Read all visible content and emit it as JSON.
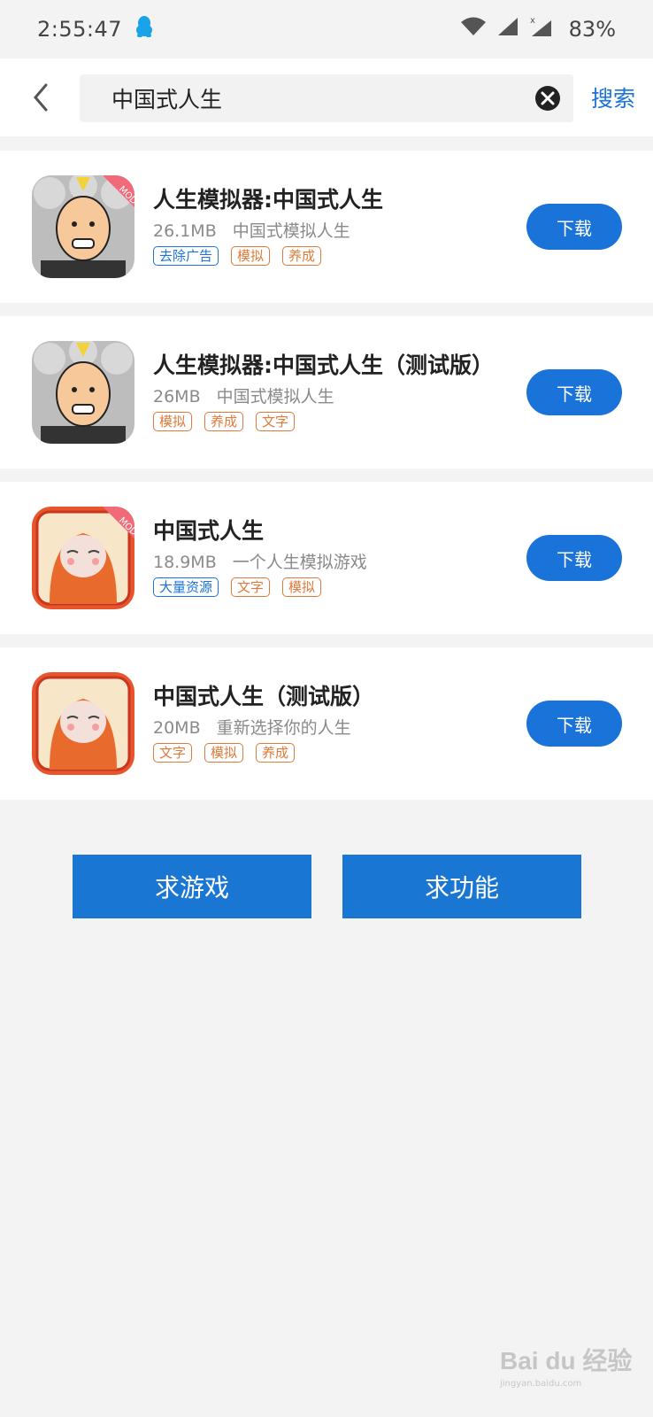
{
  "status_bar": {
    "time": "2:55:47",
    "battery": "83%",
    "icons": [
      "qq-icon",
      "wifi-icon",
      "signal-icon",
      "signal-no-service-icon"
    ]
  },
  "search": {
    "query": "中国式人生",
    "button_label": "搜索"
  },
  "results": [
    {
      "title": "人生模拟器:中国式人生",
      "size": "26.1MB",
      "desc": "中国式模拟人生",
      "tags": [
        {
          "label": "去除广告",
          "color": "#1a73d9"
        },
        {
          "label": "模拟",
          "color": "#e07a3a"
        },
        {
          "label": "养成",
          "color": "#e07a3a"
        }
      ],
      "button": "下载",
      "badge": "MOD"
    },
    {
      "title": "人生模拟器:中国式人生（测试版）",
      "size": "26MB",
      "desc": "中国式模拟人生",
      "tags": [
        {
          "label": "模拟",
          "color": "#e07a3a"
        },
        {
          "label": "养成",
          "color": "#e07a3a"
        },
        {
          "label": "文字",
          "color": "#e07a3a"
        }
      ],
      "button": "下载",
      "badge": ""
    },
    {
      "title": "中国式人生",
      "size": "18.9MB",
      "desc": "一个人生模拟游戏",
      "tags": [
        {
          "label": "大量资源",
          "color": "#1a73d9"
        },
        {
          "label": "文字",
          "color": "#e07a3a"
        },
        {
          "label": "模拟",
          "color": "#e07a3a"
        }
      ],
      "button": "下载",
      "badge": "MOD"
    },
    {
      "title": "中国式人生（测试版）",
      "size": "20MB",
      "desc": "重新选择你的人生",
      "tags": [
        {
          "label": "文字",
          "color": "#e07a3a"
        },
        {
          "label": "模拟",
          "color": "#e07a3a"
        },
        {
          "label": "养成",
          "color": "#e07a3a"
        }
      ],
      "button": "下载",
      "badge": ""
    }
  ],
  "actions": {
    "request_game": "求游戏",
    "request_feature": "求功能"
  },
  "watermark": {
    "brand": "Bai du 经验",
    "url": "jingyan.baidu.com"
  },
  "colors": {
    "accent": "#1a73d9",
    "tag_orange": "#e07a3a",
    "background": "#f3f3f3"
  }
}
